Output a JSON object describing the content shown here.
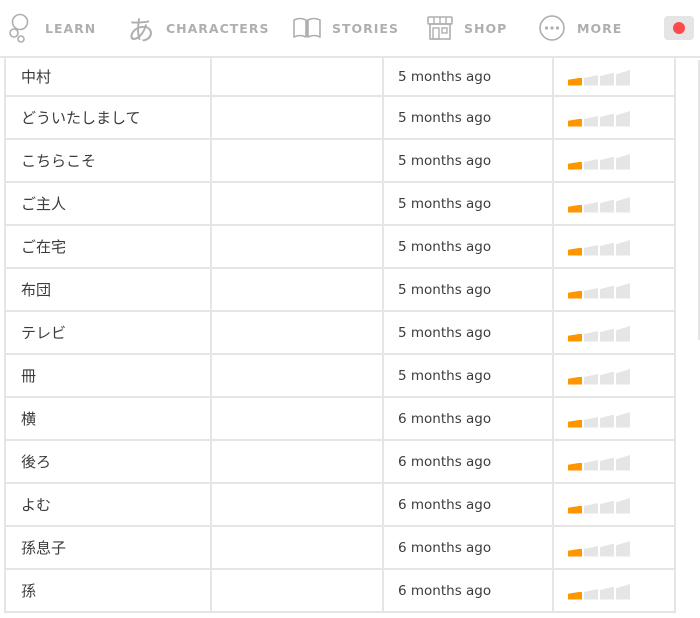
{
  "nav": {
    "learn": "LEARN",
    "characters": "CHARACTERS",
    "characters_glyph": "あ",
    "stories": "STORIES",
    "shop": "SHOP",
    "more": "MORE"
  },
  "colors": {
    "accent": "#ff9600",
    "bar_off": "#e5e5e5",
    "record": "#ff4b4b",
    "nav_text": "#afafaf"
  },
  "words": [
    {
      "word": "中村",
      "last_practiced": "5 months ago",
      "strength": 1
    },
    {
      "word": "どういたしまして",
      "last_practiced": "5 months ago",
      "strength": 1
    },
    {
      "word": "こちらこそ",
      "last_practiced": "5 months ago",
      "strength": 1
    },
    {
      "word": "ご主人",
      "last_practiced": "5 months ago",
      "strength": 1
    },
    {
      "word": "ご在宅",
      "last_practiced": "5 months ago",
      "strength": 1
    },
    {
      "word": "布団",
      "last_practiced": "5 months ago",
      "strength": 1
    },
    {
      "word": "テレビ",
      "last_practiced": "5 months ago",
      "strength": 1
    },
    {
      "word": "冊",
      "last_practiced": "5 months ago",
      "strength": 1
    },
    {
      "word": "横",
      "last_practiced": "6 months ago",
      "strength": 1
    },
    {
      "word": "後ろ",
      "last_practiced": "6 months ago",
      "strength": 1
    },
    {
      "word": "よむ",
      "last_practiced": "6 months ago",
      "strength": 1
    },
    {
      "word": "孫息子",
      "last_practiced": "6 months ago",
      "strength": 1
    },
    {
      "word": "孫",
      "last_practiced": "6 months ago",
      "strength": 1
    }
  ],
  "strength_levels": 4
}
